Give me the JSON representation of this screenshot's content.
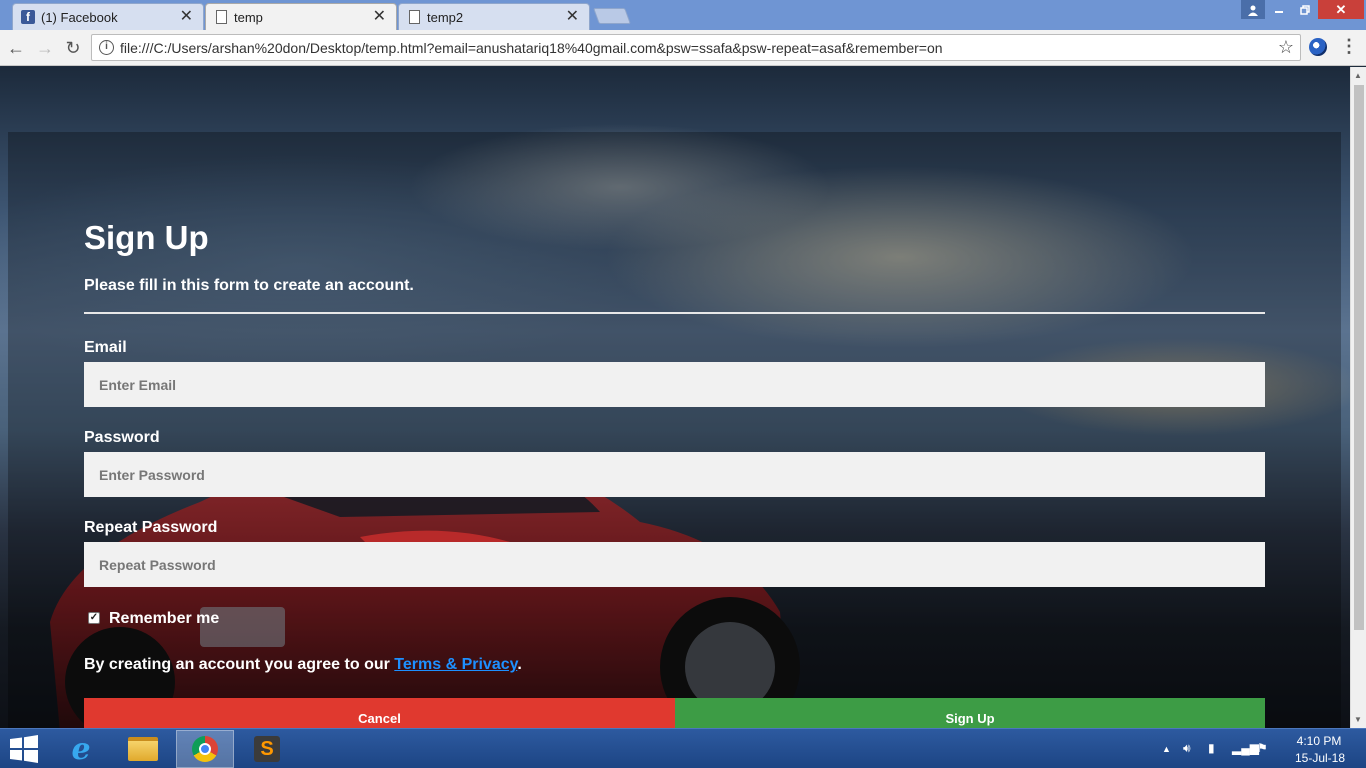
{
  "browser": {
    "tabs": [
      {
        "title": "(1) Facebook",
        "icon": "facebook-icon"
      },
      {
        "title": "temp",
        "icon": "page-icon",
        "active": true
      },
      {
        "title": "temp2",
        "icon": "page-icon"
      }
    ],
    "url": "file:///C:/Users/arshan%20don/Desktop/temp.html?email=anushatariq18%40gmail.com&psw=ssafa&psw-repeat=asaf&remember=on"
  },
  "form": {
    "title": "Sign Up",
    "subtitle": "Please fill in this form to create an account.",
    "email_label": "Email",
    "email_placeholder": "Enter Email",
    "password_label": "Password",
    "password_placeholder": "Enter Password",
    "repeat_label": "Repeat Password",
    "repeat_placeholder": "Repeat Password",
    "remember_label": "Remember me",
    "remember_checked": true,
    "terms_prefix": "By creating an account you agree to our ",
    "terms_link": "Terms & Privacy",
    "terms_suffix": ".",
    "cancel_label": "Cancel",
    "signup_label": "Sign Up",
    "cancel_color": "#e0392f",
    "signup_color": "#3d9c45"
  },
  "taskbar": {
    "time": "4:10 PM",
    "date": "15-Jul-18"
  }
}
